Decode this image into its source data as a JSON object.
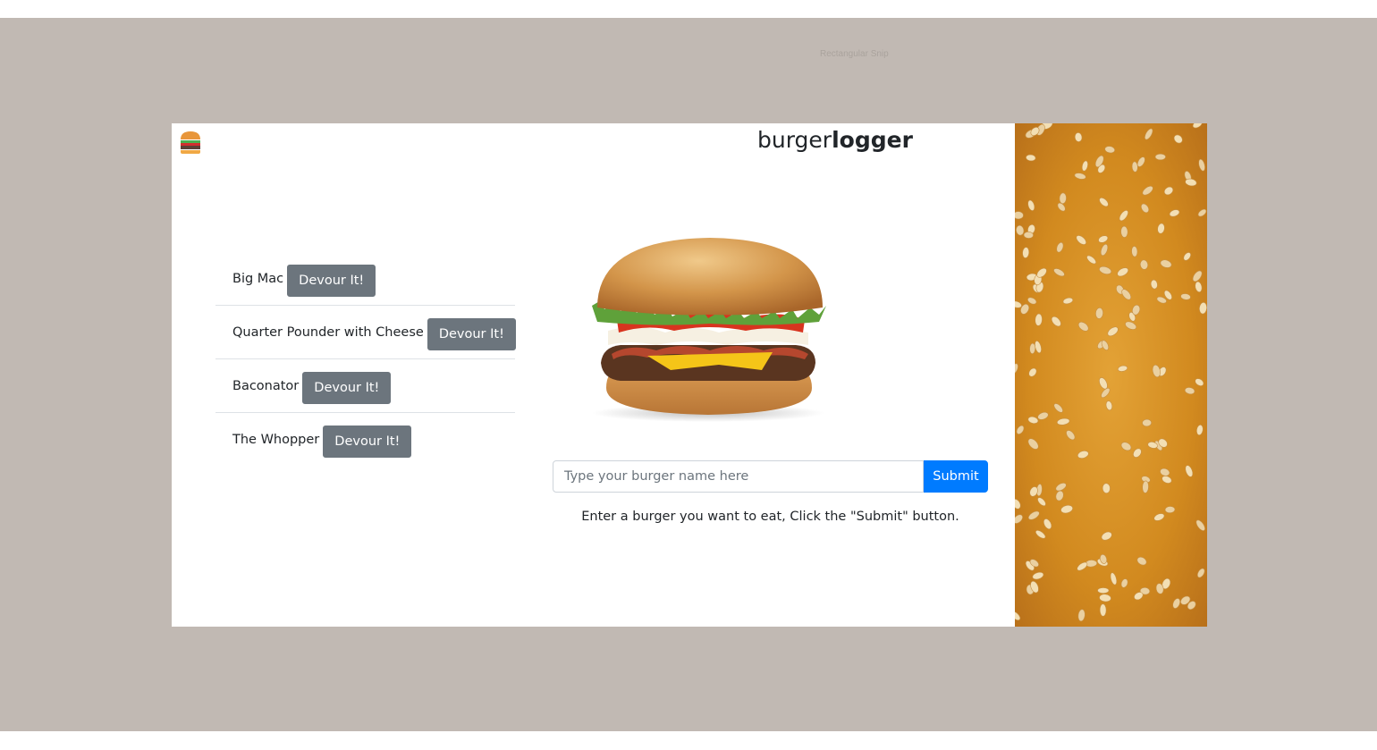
{
  "screen": {
    "snip_label": "Rectangular Snip"
  },
  "header": {
    "brand_light": "burger",
    "brand_bold": "logger",
    "logo_icon": "burger-icon"
  },
  "burgers": [
    {
      "name": "Big Mac",
      "button_label": "Devour It!"
    },
    {
      "name": "Quarter Pounder with Cheese",
      "button_label": "Devour It!"
    },
    {
      "name": "Baconator",
      "button_label": "Devour It!"
    },
    {
      "name": "The Whopper",
      "button_label": "Devour It!"
    }
  ],
  "form": {
    "placeholder": "Type your burger name here",
    "value": "",
    "submit_label": "Submit"
  },
  "hint": "Enter a burger you want to eat, Click the \"Submit\" button.",
  "colors": {
    "backdrop": "#c1b9b3",
    "devour_button": "#6c757d",
    "submit_button": "#007bff",
    "seed_background": "#d28a1f"
  }
}
